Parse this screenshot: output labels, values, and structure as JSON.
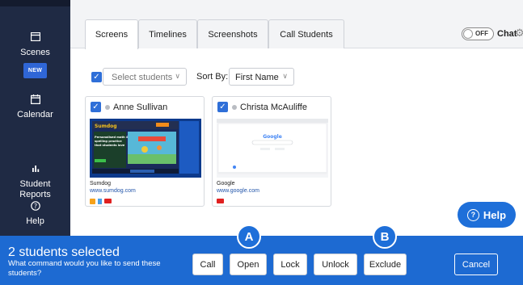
{
  "sidebar": {
    "items": [
      {
        "label": "Scenes",
        "icon": "scenes-icon",
        "badge": "NEW"
      },
      {
        "label": "Calendar",
        "icon": "calendar-icon"
      },
      {
        "label": "Student\nReports",
        "icon": "reports-icon"
      },
      {
        "label": "Help",
        "icon": "help-icon"
      }
    ]
  },
  "tabs": [
    {
      "label": "Screens",
      "active": true
    },
    {
      "label": "Timelines",
      "active": false
    },
    {
      "label": "Screenshots",
      "active": false
    },
    {
      "label": "Call Students",
      "active": false
    }
  ],
  "chat": {
    "toggle_state": "OFF",
    "label": "Chat"
  },
  "filters": {
    "select_placeholder": "Select students",
    "sort_label": "Sort By:",
    "sort_value": "First Name"
  },
  "cards": [
    {
      "name": "Anne Sullivan",
      "site": "Sumdog",
      "url": "www.sumdog.com",
      "thumb_text": "Personalised math & spelling practice that students love",
      "thumb_button": "Get started"
    },
    {
      "name": "Christa McAuliffe",
      "site": "Google",
      "url": "www.google.com",
      "thumb_text": "Google"
    }
  ],
  "help_button": {
    "label": "Help"
  },
  "bottom": {
    "title": "2 students selected",
    "subtitle": "What command would you like to send these students?",
    "buttons": [
      "Call",
      "Open",
      "Lock",
      "Unlock",
      "Exclude"
    ],
    "cancel": "Cancel"
  },
  "callouts": [
    "A",
    "B"
  ],
  "colors": {
    "sidebar": "#1f2a44",
    "accent": "#1d6ad2",
    "checkbox": "#2f6fd8"
  }
}
